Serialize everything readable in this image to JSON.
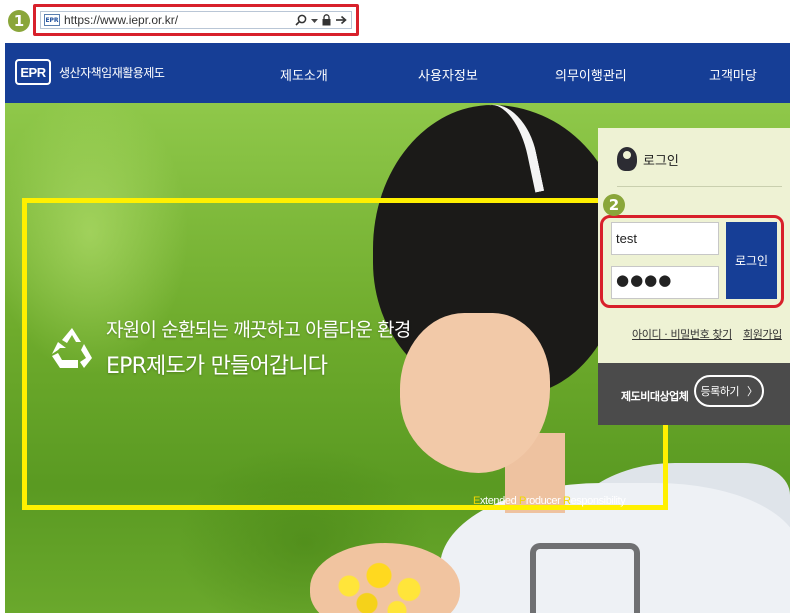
{
  "annotations": {
    "step1": "1",
    "step2": "2"
  },
  "address_bar": {
    "url": "https://www.iepr.or.kr/",
    "favicon": "EPR"
  },
  "nav": {
    "logo_mark": "EPR",
    "logo_text": "생산자책임재활용제도",
    "menu": [
      "제도소개",
      "사용자정보",
      "의무이행관리",
      "고객마당"
    ],
    "bg_color": "#163e96"
  },
  "hero": {
    "line1": "자원이 순환되는 깨끗하고 아름다운 환경",
    "line2": "EPR제도가 만들어갑니다",
    "tagline": {
      "p1": "E",
      "p2": "xtended ",
      "p3": "P",
      "p4": "roducer ",
      "p5": "R",
      "p6": "esponsibility"
    },
    "frame_color": "#fff000"
  },
  "login": {
    "title": "로그인",
    "id_value": "test",
    "pw_value": "●●●●",
    "button": "로그인",
    "find_link": "아이디 · 비밀번호 찾기",
    "join_link": "회원가입",
    "reg_label": "제도비대상업체",
    "reg_button": "등록하기",
    "reg_arrow": "〉"
  },
  "icons": [
    "search-icon",
    "dropdown-icon",
    "lock-icon",
    "go-arrow-icon",
    "recycle-icon",
    "user-icon"
  ],
  "highlight_color": "#d8202b"
}
